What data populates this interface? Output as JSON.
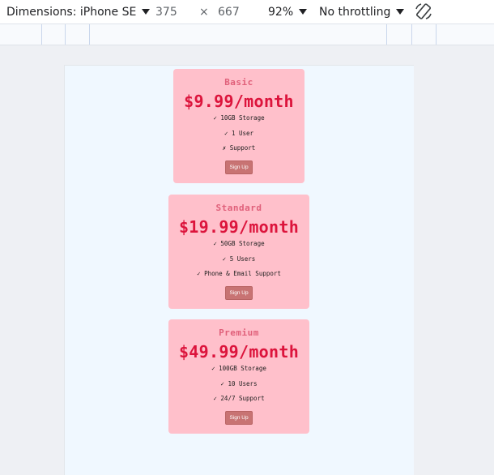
{
  "toolbar": {
    "dimensions_label": "Dimensions: iPhone SE",
    "width": "375",
    "times": "×",
    "height": "667",
    "zoom": "92%",
    "throttling": "No throttling"
  },
  "plans": [
    {
      "name": "Basic",
      "price": "$9.99/month",
      "features": [
        "✓ 10GB Storage",
        "✓ 1 User",
        "✗ Support"
      ],
      "button": "Sign Up"
    },
    {
      "name": "Standard",
      "price": "$19.99/month",
      "features": [
        "✓ 50GB Storage",
        "✓ 5 Users",
        "✓ Phone & Email Support"
      ],
      "button": "Sign Up"
    },
    {
      "name": "Premium",
      "price": "$49.99/month",
      "features": [
        "✓ 100GB Storage",
        "✓ 10 Users",
        "✓ 24/7 Support"
      ],
      "button": "Sign Up"
    }
  ],
  "colors": {
    "card_bg": "#ffc0cb",
    "price": "#dc143c",
    "plan_name": "#e0607a",
    "button": "#c87373",
    "viewport_bg": "#f0f8ff"
  }
}
